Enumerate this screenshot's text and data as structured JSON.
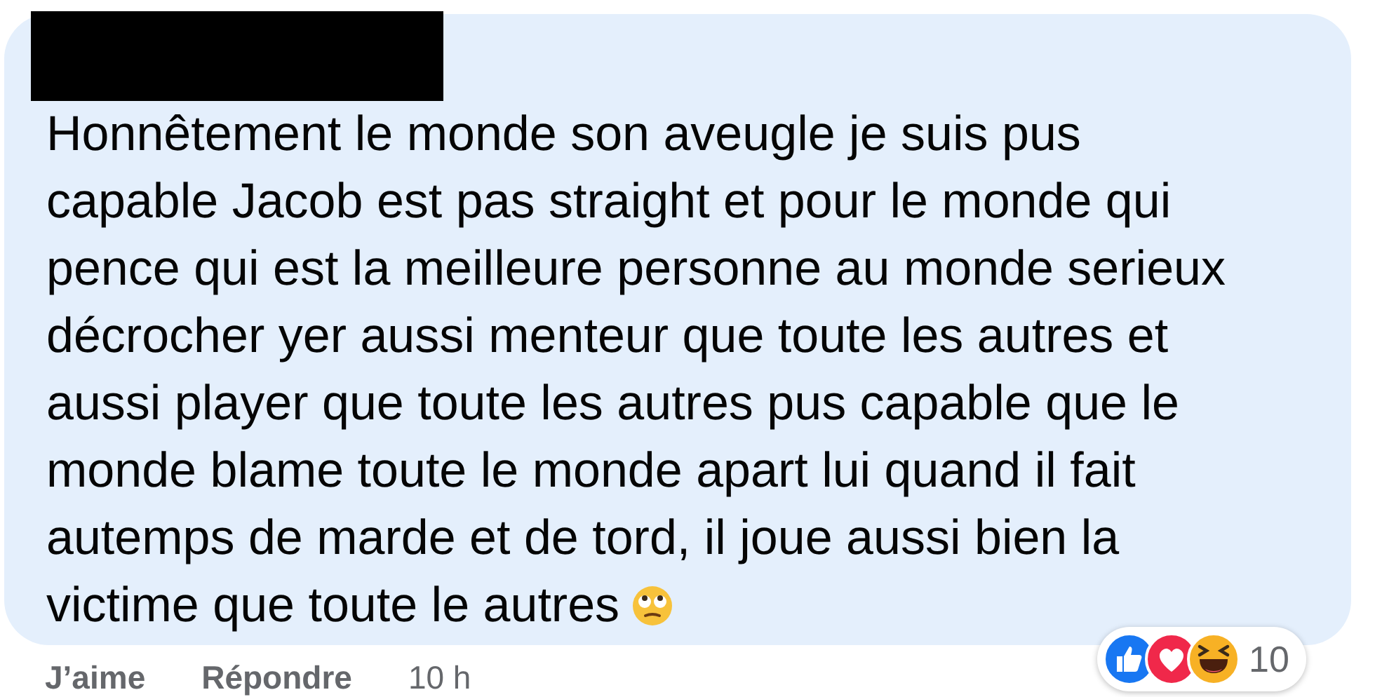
{
  "comment": {
    "author_redacted": true,
    "lines": [
      "Honnêtement le monde son aveugle je suis pus",
      "capable Jacob est pas straight et pour le monde qui",
      "pence qui est la meilleure personne au monde serieux",
      "décrocher yer aussi menteur que toute les autres et",
      "aussi player que toute les autres pus capable que le",
      "monde blame toute le monde apart lui quand il fait",
      "autemps de marde et de tord, il joue aussi bien la",
      "victime que toute le autres"
    ],
    "reactions": {
      "count": "10"
    },
    "actions": [
      {
        "label": "J’aime"
      },
      {
        "label": "Répondre"
      }
    ],
    "time": "10 h"
  }
}
